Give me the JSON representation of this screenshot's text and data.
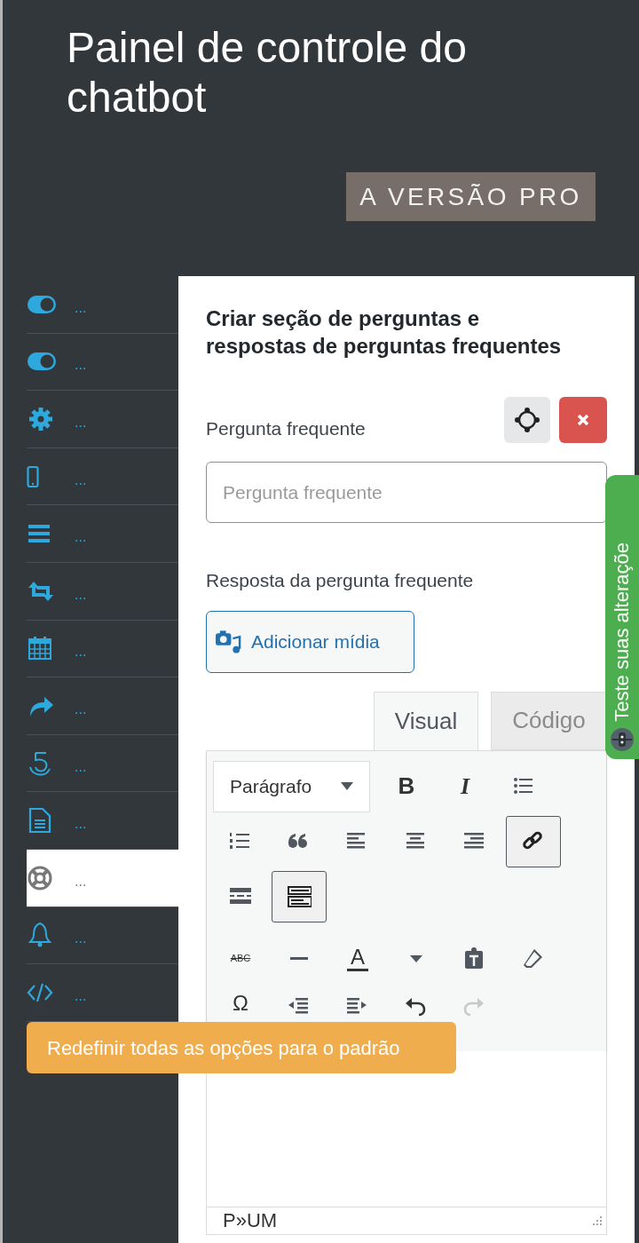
{
  "title": "Painel de controle do chatbot",
  "pro_button": "A VERSÃO PRO",
  "sidebar": {
    "items": [
      {
        "kind": "toggle",
        "label": "...",
        "selected": false
      },
      {
        "kind": "toggle",
        "label": "...",
        "selected": false
      },
      {
        "kind": "gear",
        "label": "...",
        "selected": false
      },
      {
        "kind": "phone",
        "label": "...",
        "selected": false
      },
      {
        "kind": "bars",
        "label": "...",
        "selected": false
      },
      {
        "kind": "repeat",
        "label": "...",
        "selected": false
      },
      {
        "kind": "calendar",
        "label": "...",
        "selected": false
      },
      {
        "kind": "share",
        "label": "...",
        "selected": false
      },
      {
        "kind": "spiral",
        "label": "...",
        "selected": false
      },
      {
        "kind": "document",
        "label": "...",
        "selected": false
      },
      {
        "kind": "lifebuoy",
        "label": "...",
        "selected": true
      },
      {
        "kind": "bell",
        "label": "...",
        "selected": false
      },
      {
        "kind": "code",
        "label": "...",
        "selected": false
      }
    ]
  },
  "panel": {
    "heading": "Criar seção de perguntas e respostas de perguntas frequentes",
    "question_label": "Pergunta frequente",
    "question_field": {
      "placeholder": "Pergunta frequente"
    },
    "answer_label": "Resposta da pergunta frequente",
    "media_button": "Adicionar mídia",
    "editor": {
      "tabs": [
        {
          "label": "Visual",
          "selected": true
        },
        {
          "label": "Código",
          "selected": false
        }
      ],
      "format_select": "Parágrafo",
      "toolbar_rows": [
        [
          {
            "kind": "bold",
            "glyph": "B",
            "pressed": false,
            "disabled": false
          },
          {
            "kind": "italic",
            "glyph": "I",
            "pressed": false,
            "disabled": false
          },
          {
            "kind": "bullet-list",
            "pressed": false,
            "disabled": false
          }
        ],
        [
          {
            "kind": "numbered-list",
            "pressed": false,
            "disabled": false
          },
          {
            "kind": "quote",
            "pressed": false,
            "disabled": false
          },
          {
            "kind": "align-left",
            "pressed": false,
            "disabled": false
          },
          {
            "kind": "align-center",
            "pressed": false,
            "disabled": false
          },
          {
            "kind": "align-right",
            "pressed": false,
            "disabled": false
          },
          {
            "kind": "link",
            "pressed": true,
            "disabled": false
          }
        ],
        [
          {
            "kind": "read-more",
            "pressed": false,
            "disabled": false
          },
          {
            "kind": "toolbar-toggle",
            "pressed": true,
            "disabled": false
          }
        ],
        [
          {
            "kind": "strikethrough",
            "glyph": "ABC",
            "pressed": false,
            "disabled": false
          },
          {
            "kind": "horizontal-line",
            "pressed": false,
            "disabled": false
          },
          {
            "kind": "text-color",
            "glyph": "A",
            "pressed": false,
            "disabled": false
          },
          {
            "kind": "caret",
            "pressed": false,
            "disabled": false
          },
          {
            "kind": "paste-text",
            "pressed": false,
            "disabled": false
          },
          {
            "kind": "eraser",
            "pressed": false,
            "disabled": false
          }
        ],
        [
          {
            "kind": "special-char",
            "glyph": "Ω",
            "pressed": false,
            "disabled": false
          },
          {
            "kind": "outdent",
            "pressed": false,
            "disabled": false
          },
          {
            "kind": "indent",
            "pressed": false,
            "disabled": false
          },
          {
            "kind": "undo",
            "pressed": false,
            "disabled": false
          },
          {
            "kind": "redo",
            "pressed": false,
            "disabled": true
          }
        ]
      ],
      "path": "P»UM"
    }
  },
  "test_tab": "Teste suas alteraçõe",
  "reset_button": "Redefinir todas as opções para o padrão"
}
